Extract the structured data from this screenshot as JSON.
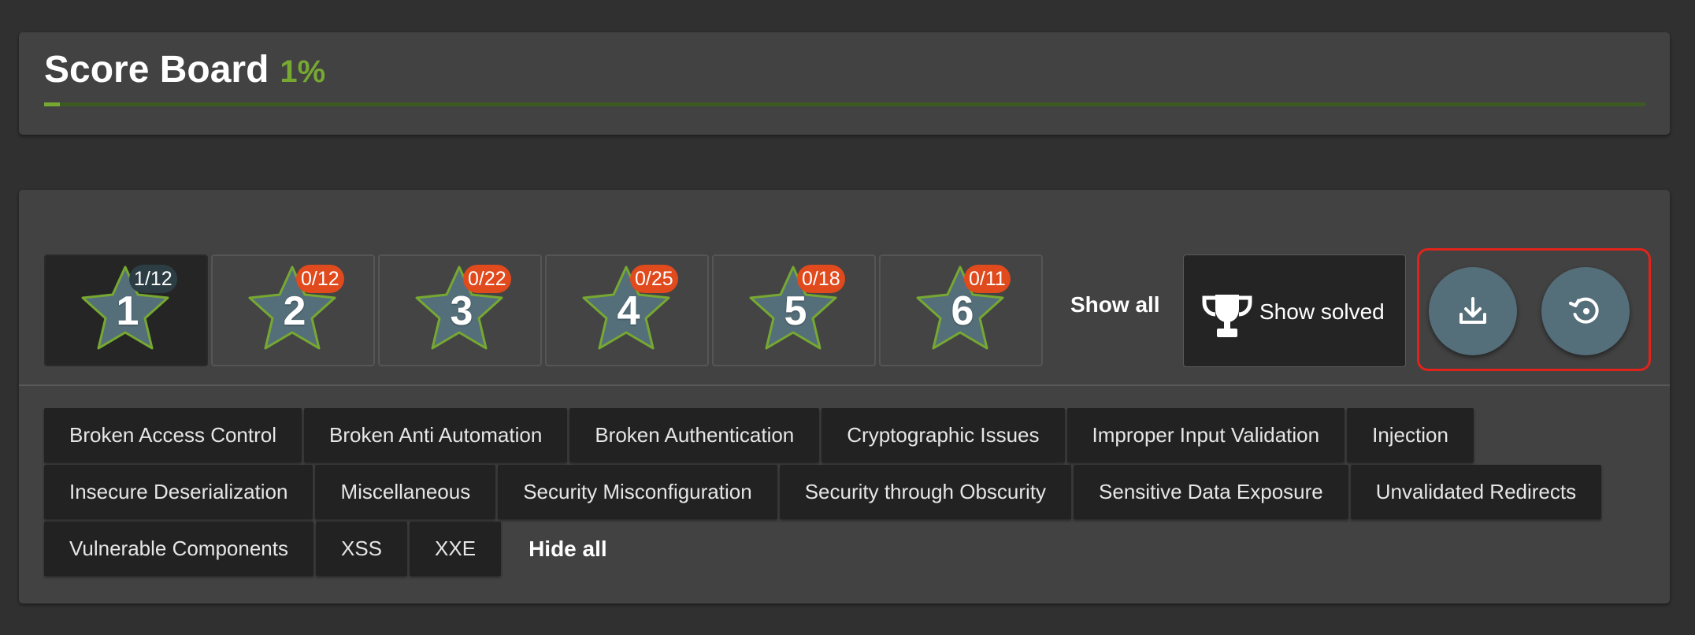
{
  "header": {
    "title": "Score Board",
    "percent": "1%",
    "progress_fraction": 0.01
  },
  "colors": {
    "accent_green": "#76a832",
    "badge_orange": "#e04a1d",
    "highlight_red": "#e0241b",
    "star_fill": "#546e7a"
  },
  "difficulty": {
    "stars": [
      {
        "level": "1",
        "badge": "1/12",
        "active": true
      },
      {
        "level": "2",
        "badge": "0/12",
        "active": false
      },
      {
        "level": "3",
        "badge": "0/22",
        "active": false
      },
      {
        "level": "4",
        "badge": "0/25",
        "active": false
      },
      {
        "level": "5",
        "badge": "0/18",
        "active": false
      },
      {
        "level": "6",
        "badge": "0/11",
        "active": false
      }
    ],
    "show_all_label": "Show all",
    "show_solved_label": "Show solved",
    "show_solved_icon": "trophy-icon",
    "download_icon": "download-icon",
    "reset_icon": "restore-icon"
  },
  "categories": {
    "rows": [
      [
        "Broken Access Control",
        "Broken Anti Automation",
        "Broken Authentication",
        "Cryptographic Issues",
        "Improper Input Validation",
        "Injection"
      ],
      [
        "Insecure Deserialization",
        "Miscellaneous",
        "Security Misconfiguration",
        "Security through Obscurity",
        "Sensitive Data Exposure",
        "Unvalidated Redirects"
      ],
      [
        "Vulnerable Components",
        "XSS",
        "XXE"
      ]
    ],
    "hide_all_label": "Hide all"
  }
}
